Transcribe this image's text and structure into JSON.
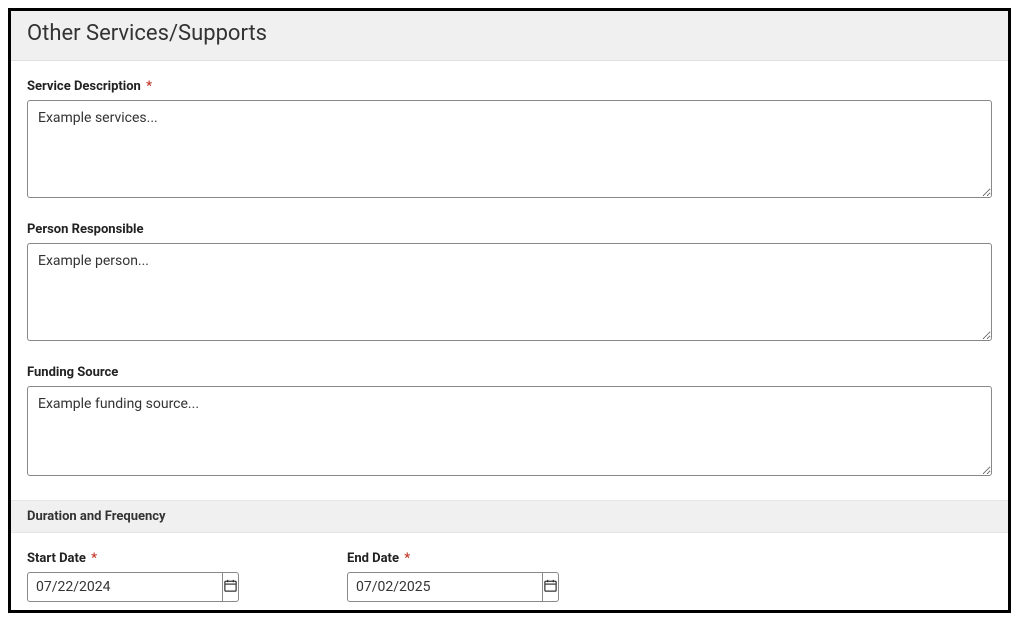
{
  "header": {
    "title": "Other Services/Supports"
  },
  "fields": {
    "service_description": {
      "label": "Service Description",
      "required_marker": "*",
      "value": "Example services..."
    },
    "person_responsible": {
      "label": "Person Responsible",
      "value": "Example person..."
    },
    "funding_source": {
      "label": "Funding Source",
      "value": "Example funding source..."
    }
  },
  "duration": {
    "header": "Duration and Frequency",
    "start_date": {
      "label": "Start Date",
      "required_marker": "*",
      "value": "07/22/2024"
    },
    "end_date": {
      "label": "End Date",
      "required_marker": "*",
      "value": "07/02/2025"
    }
  }
}
